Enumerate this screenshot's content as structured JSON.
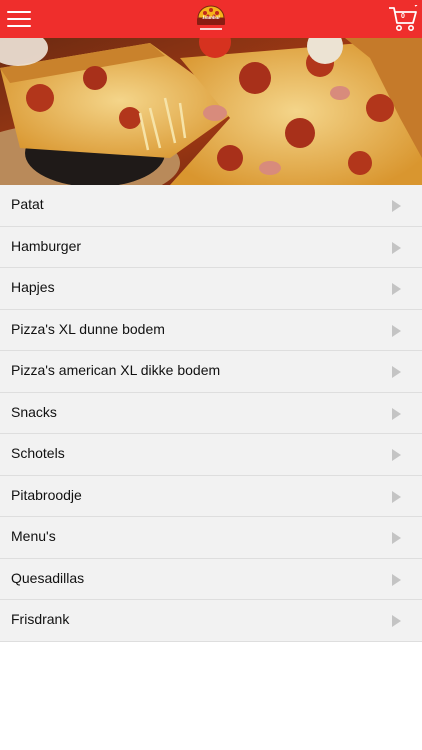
{
  "header": {
    "logo_text": "Istanbul",
    "cart_count": "0",
    "menu_icon": "hamburger-menu-icon",
    "cart_icon": "shopping-cart-icon",
    "background_color": "#ef2e2c"
  },
  "hero": {
    "image": "pizza-photo"
  },
  "categories": [
    {
      "label": "Patat"
    },
    {
      "label": "Hamburger"
    },
    {
      "label": "Hapjes"
    },
    {
      "label": "Pizza's XL dunne bodem"
    },
    {
      "label": "Pizza's american XL dikke bodem"
    },
    {
      "label": "Snacks"
    },
    {
      "label": "Schotels"
    },
    {
      "label": "Pitabroodje"
    },
    {
      "label": "Menu's"
    },
    {
      "label": "Quesadillas"
    },
    {
      "label": "Frisdrank"
    }
  ]
}
